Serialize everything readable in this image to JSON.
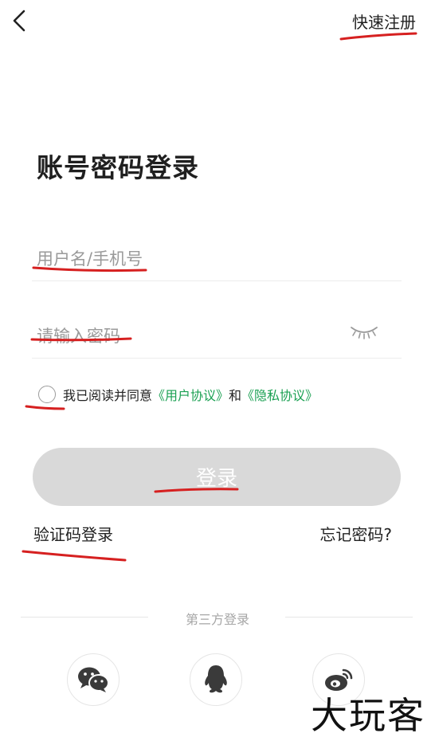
{
  "header": {
    "back_icon": "chevron-left-icon",
    "register_label": "快速注册"
  },
  "title": "账号密码登录",
  "form": {
    "username_placeholder": "用户名/手机号",
    "username_value": "",
    "password_placeholder": "请输入密码",
    "password_value": "",
    "eye_icon": "eye-closed-icon"
  },
  "agreement": {
    "prefix": "我已阅读并同意",
    "user_agreement": "《用户协议》",
    "and": "和",
    "privacy_policy": "《隐私协议》",
    "link_color": "#1aa052"
  },
  "login_button": "登录",
  "sms_login": "验证码登录",
  "forgot_password": "忘记密码?",
  "third_party": {
    "label": "第三方登录",
    "providers": [
      "wechat-icon",
      "qq-icon",
      "weibo-icon"
    ]
  },
  "watermark": "大玩客",
  "annotation_color": "#d62020"
}
